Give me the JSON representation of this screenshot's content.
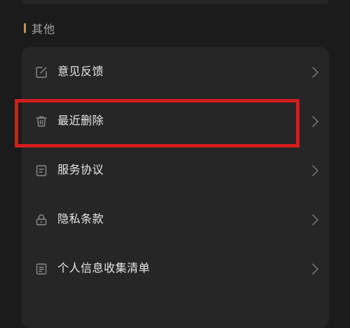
{
  "section": {
    "title": "其他"
  },
  "menu": {
    "items": [
      {
        "icon": "feedback-edit-icon",
        "label": "意见反馈"
      },
      {
        "icon": "trash-icon",
        "label": "最近删除"
      },
      {
        "icon": "document-icon",
        "label": "服务协议"
      },
      {
        "icon": "lock-icon",
        "label": "隐私条款"
      },
      {
        "icon": "list-document-icon",
        "label": "个人信息收集清单"
      }
    ]
  },
  "highlight": {
    "target": "最近删除",
    "color": "#d11d1d"
  },
  "colors": {
    "background": "#1b1b1b",
    "card": "#262626",
    "accent": "#b6956a",
    "text": "#e7e7e7",
    "muted": "#a3a3a3",
    "icon": "#8a8a8a"
  }
}
